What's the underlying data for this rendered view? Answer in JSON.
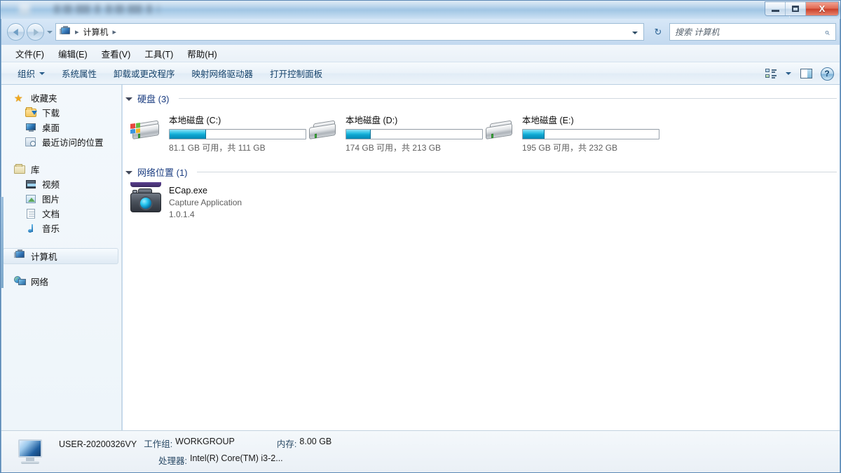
{
  "window": {
    "controls": {
      "minimize": "–",
      "maximize": "□",
      "close": "X"
    }
  },
  "nav": {
    "back_tooltip": "后退",
    "forward_tooltip": "前进",
    "breadcrumb": {
      "root_icon": "computer-icon",
      "sep1": "▸",
      "item": "计算机",
      "sep2": "▸"
    },
    "refresh_glyph": "↻",
    "dropdown_glyph": "▾"
  },
  "search": {
    "placeholder": "搜索 计算机",
    "value": "",
    "icon_glyph": "⌕"
  },
  "menubar": {
    "items": [
      {
        "label": "文件(F)"
      },
      {
        "label": "编辑(E)"
      },
      {
        "label": "查看(V)"
      },
      {
        "label": "工具(T)"
      },
      {
        "label": "帮助(H)"
      }
    ]
  },
  "toolbar": {
    "items": [
      {
        "label": "组织",
        "has_caret": true
      },
      {
        "label": "系统属性",
        "has_caret": false
      },
      {
        "label": "卸载或更改程序",
        "has_caret": false
      },
      {
        "label": "映射网络驱动器",
        "has_caret": false
      },
      {
        "label": "打开控制面板",
        "has_caret": false
      }
    ],
    "view_icon": "view-mode-icon",
    "view_caret": "▾",
    "preview_icon": "preview-pane-icon",
    "help_label": "?"
  },
  "sidebar": {
    "groups": [
      {
        "name": "favorites",
        "header": {
          "label": "收藏夹",
          "icon": "star-icon"
        },
        "items": [
          {
            "label": "下载",
            "icon": "download-folder-icon"
          },
          {
            "label": "桌面",
            "icon": "desktop-icon"
          },
          {
            "label": "最近访问的位置",
            "icon": "recent-places-icon"
          }
        ]
      },
      {
        "name": "libraries",
        "header": {
          "label": "库",
          "icon": "library-icon"
        },
        "items": [
          {
            "label": "视频",
            "icon": "video-icon"
          },
          {
            "label": "图片",
            "icon": "pictures-icon"
          },
          {
            "label": "文档",
            "icon": "documents-icon"
          },
          {
            "label": "音乐",
            "icon": "music-icon"
          }
        ]
      }
    ],
    "computer": {
      "label": "计算机",
      "icon": "computer-icon",
      "selected": true
    },
    "network": {
      "label": "网络",
      "icon": "network-icon"
    }
  },
  "content": {
    "groups": [
      {
        "id": "hard-disks",
        "title": "硬盘 (3)",
        "expanded": true,
        "drives": [
          {
            "name": "本地磁盘 (C:)",
            "capacity_label": "81.1 GB 可用，共 111 GB",
            "free_gb": 81.1,
            "total_gb": 111,
            "used_percent": 27,
            "is_system": true
          },
          {
            "name": "本地磁盘 (D:)",
            "capacity_label": "174 GB 可用，共 213 GB",
            "free_gb": 174,
            "total_gb": 213,
            "used_percent": 18,
            "is_system": false
          },
          {
            "name": "本地磁盘 (E:)",
            "capacity_label": "195 GB 可用，共 232 GB",
            "free_gb": 195,
            "total_gb": 232,
            "used_percent": 16,
            "is_system": false
          }
        ]
      },
      {
        "id": "network-locations",
        "title": "网络位置 (1)",
        "expanded": true,
        "items": [
          {
            "name": "ECap.exe",
            "description": "Capture Application",
            "version": "1.0.1.4",
            "icon": "camera-icon"
          }
        ]
      }
    ]
  },
  "statusbar": {
    "computer_name": "USER-20200326VY",
    "workgroup_label": "工作组:",
    "workgroup_value": "WORKGROUP",
    "memory_label": "内存:",
    "memory_value": "8.00 GB",
    "processor_label": "处理器:",
    "processor_value": "Intel(R) Core(TM) i3-2..."
  },
  "colors": {
    "accent_blue": "#1a3c80",
    "bar_fill": "#0fa7d1",
    "close_red": "#c9402a",
    "toolbar_text": "#16436b"
  }
}
